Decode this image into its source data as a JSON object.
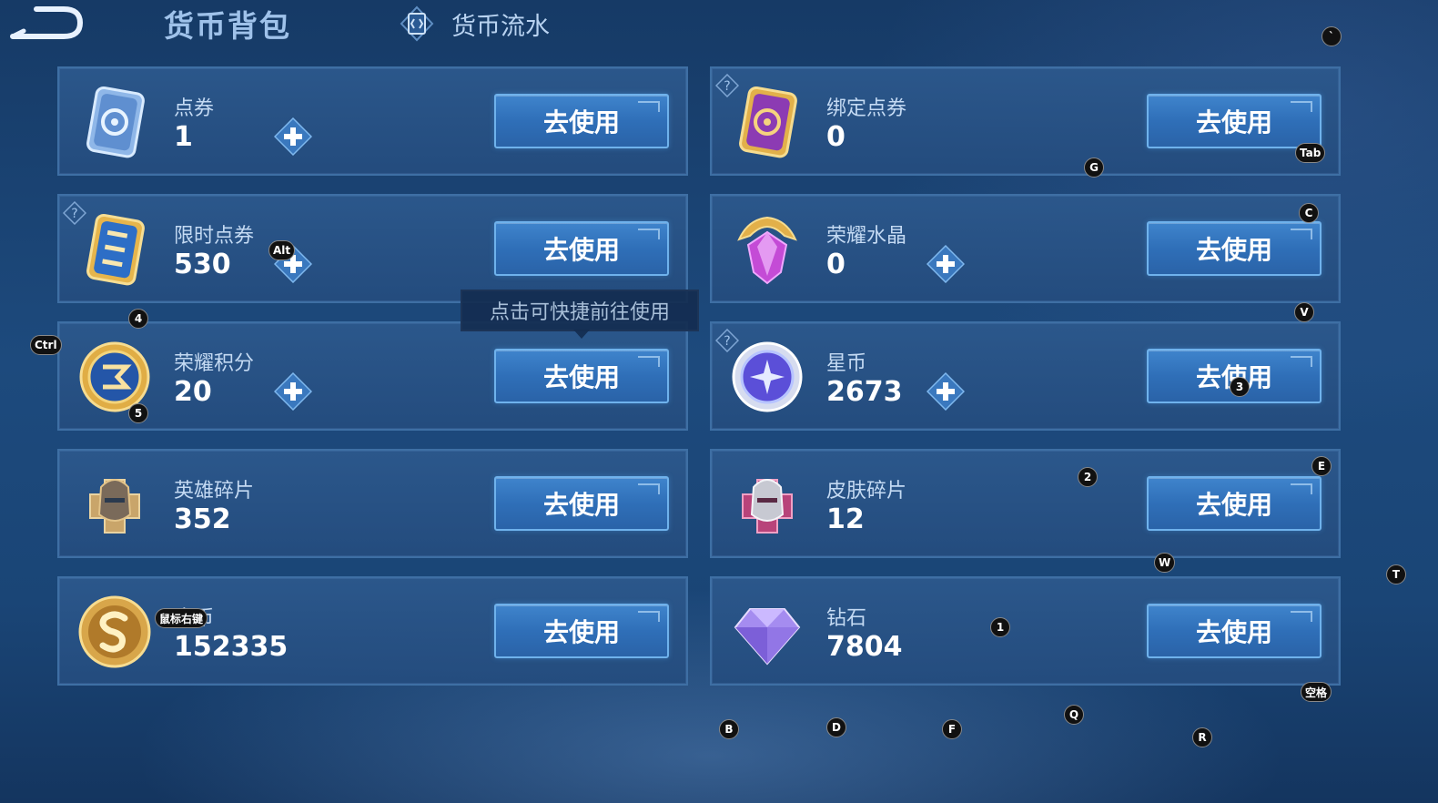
{
  "header": {
    "title": "货币背包",
    "flow_tab_label": "货币流水"
  },
  "use_label": "去使用",
  "tooltip": "点击可快捷前往使用",
  "currencies": [
    {
      "name": "点券",
      "value": "1",
      "icon": "ticket-icon"
    },
    {
      "name": "绑定点券",
      "value": "0",
      "icon": "bound-ticket-icon"
    },
    {
      "name": "限时点券",
      "value": "530",
      "icon": "limited-ticket-icon"
    },
    {
      "name": "荣耀水晶",
      "value": "0",
      "icon": "glory-crystal-icon"
    },
    {
      "name": "荣耀积分",
      "value": "20",
      "icon": "glory-points-icon"
    },
    {
      "name": "星币",
      "value": "2673",
      "icon": "star-coin-icon"
    },
    {
      "name": "英雄碎片",
      "value": "352",
      "icon": "hero-fragment-icon"
    },
    {
      "name": "皮肤碎片",
      "value": "12",
      "icon": "skin-fragment-icon"
    },
    {
      "name": "金币",
      "value": "152335",
      "icon": "gold-coin-icon"
    },
    {
      "name": "钻石",
      "value": "7804",
      "icon": "diamond-icon"
    }
  ],
  "hotkeys": [
    "`",
    "Tab",
    "G",
    "C",
    "Alt",
    "4",
    "V",
    "Ctrl",
    "5",
    "3",
    "2",
    "E",
    "W",
    "T",
    "鼠标右键",
    "1",
    "空格",
    "Q",
    "B",
    "D",
    "F",
    "R"
  ],
  "colors": {
    "background": "#1d4a7d",
    "card": "#2c588c",
    "button": "#3f84cc",
    "button_border": "#6fb2ec",
    "label": "#c4daf3"
  }
}
